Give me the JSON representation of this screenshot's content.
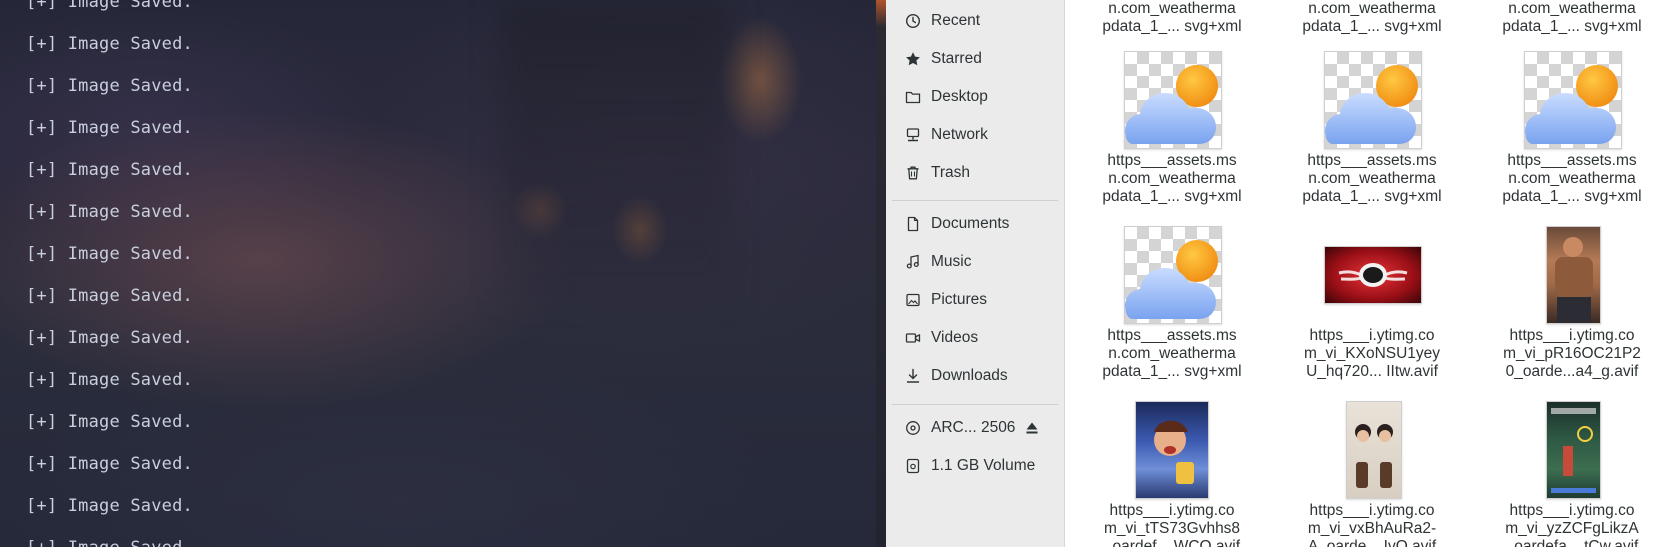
{
  "terminal": {
    "lines": [
      "[+] Image Saved.",
      "[+] Image Saved.",
      "[+] Image Saved.",
      "[+] Image Saved.",
      "[+] Image Saved.",
      "[+] Image Saved.",
      "[+] Image Saved.",
      "[+] Image Saved.",
      "[+] Image Saved.",
      "[+] Image Saved.",
      "[+] Image Saved.",
      "[+] Image Saved.",
      "[+] Image Saved.",
      "[+] Image Saved."
    ]
  },
  "sidebar": {
    "items": [
      {
        "label": "Recent",
        "icon": "clock-icon"
      },
      {
        "label": "Starred",
        "icon": "star-icon"
      },
      {
        "label": "Desktop",
        "icon": "folder-icon"
      },
      {
        "label": "Network",
        "icon": "network-icon"
      },
      {
        "label": "Trash",
        "icon": "trash-icon"
      },
      {
        "label": "Documents",
        "icon": "document-icon"
      },
      {
        "label": "Music",
        "icon": "music-icon"
      },
      {
        "label": "Pictures",
        "icon": "image-icon"
      },
      {
        "label": "Videos",
        "icon": "video-icon"
      },
      {
        "label": "Downloads",
        "icon": "download-icon"
      },
      {
        "label": "ARC... 2506",
        "icon": "disc-icon",
        "eject_icon": "eject-icon"
      },
      {
        "label": "1.1 GB Volume",
        "icon": "drive-icon"
      }
    ]
  },
  "files": {
    "top_row": [
      {
        "line1": "n.com_weatherma",
        "line2": "pdata_1_... svg+xml"
      },
      {
        "line1": "n.com_weatherma",
        "line2": "pdata_1_... svg+xml"
      },
      {
        "line1": "n.com_weatherma",
        "line2": "pdata_1_... svg+xml"
      }
    ],
    "rows": [
      [
        {
          "lines": [
            "https___assets.ms",
            "n.com_weatherma",
            "pdata_1_... svg+xml"
          ],
          "thumb": "weather-icon"
        },
        {
          "lines": [
            "https___assets.ms",
            "n.com_weatherma",
            "pdata_1_... svg+xml"
          ],
          "thumb": "weather-icon"
        },
        {
          "lines": [
            "https___assets.ms",
            "n.com_weatherma",
            "pdata_1_... svg+xml"
          ],
          "thumb": "weather-icon"
        }
      ],
      [
        {
          "lines": [
            "https___assets.ms",
            "n.com_weatherma",
            "pdata_1_... svg+xml"
          ],
          "thumb": "weather-icon"
        },
        {
          "lines": [
            "https___i.ytimg.co",
            "m_vi_KXoNSU1yey",
            "U_hq720... IItw.avif"
          ],
          "thumb": "video-thumbnail"
        },
        {
          "lines": [
            "https___i.ytimg.co",
            "m_vi_pR16OC21P2",
            "0_oarde...a4_g.avif"
          ],
          "thumb": "video-thumbnail"
        }
      ],
      [
        {
          "lines": [
            "https___i.ytimg.co",
            "m_vi_tTS73Gvhhs8",
            "_oardef... WCQ.avif"
          ],
          "thumb": "video-thumbnail"
        },
        {
          "lines": [
            "https___i.ytimg.co",
            "m_vi_vxBhAuRa2-",
            "A_oarde... IvQ.avif"
          ],
          "thumb": "video-thumbnail"
        },
        {
          "lines": [
            "https___i.ytimg.co",
            "m_vi_yzZCFgLikzA",
            "_oardefa... tCw.avif"
          ],
          "thumb": "video-thumbnail"
        }
      ]
    ]
  }
}
